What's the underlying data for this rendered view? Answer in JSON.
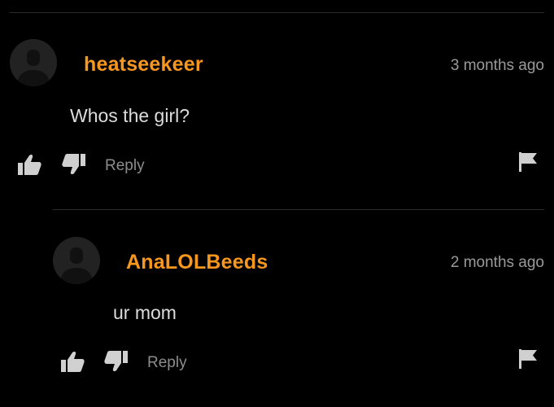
{
  "comments": [
    {
      "username": "heatseekeer",
      "time": "3 months ago",
      "text": "Whos the girl?",
      "reply_label": "Reply",
      "icons": [
        "avatar-placeholder",
        "thumbs-up-icon",
        "thumbs-down-icon",
        "flag-icon"
      ]
    },
    {
      "username": "AnaLOLBeeds",
      "time": "2 months ago",
      "text": "ur mom",
      "reply_label": "Reply",
      "icons": [
        "avatar-placeholder",
        "thumbs-up-icon",
        "thumbs-down-icon",
        "flag-icon"
      ]
    }
  ],
  "colors": {
    "background": "#000000",
    "username": "#f7971d",
    "time": "#9a9a9a",
    "text": "#dcdcdc",
    "icon": "#d0d0d0"
  }
}
